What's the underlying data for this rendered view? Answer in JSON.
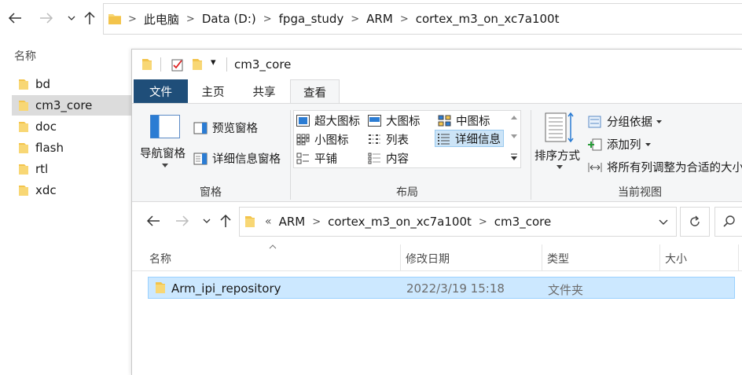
{
  "background_window": {
    "breadcrumb": [
      "此电脑",
      "Data (D:)",
      "fpga_study",
      "ARM",
      "cortex_m3_on_xc7a100t"
    ],
    "column_name": "名称",
    "sidebar_items": [
      {
        "label": "bd",
        "selected": false
      },
      {
        "label": "cm3_core",
        "selected": true
      },
      {
        "label": "doc",
        "selected": false
      },
      {
        "label": "flash",
        "selected": false
      },
      {
        "label": "rtl",
        "selected": false
      },
      {
        "label": "xdc",
        "selected": false
      }
    ]
  },
  "window": {
    "title": "cm3_core",
    "qat_dropdown": "▾",
    "tabs": {
      "file": "文件",
      "home": "主页",
      "share": "共享",
      "view": "查看",
      "active": "查看"
    },
    "ribbon": {
      "panes": {
        "nav_pane": "导航窗格",
        "preview_pane": "预览窗格",
        "details_pane": "详细信息窗格",
        "group_label": "窗格"
      },
      "layout": {
        "items": [
          "超大图标",
          "大图标",
          "中图标",
          "小图标",
          "列表",
          "详细信息",
          "平铺",
          "内容"
        ],
        "selected": "详细信息",
        "group_label": "布局"
      },
      "current_view": {
        "sort_by": "排序方式",
        "group_by": "分组依据",
        "add_columns": "添加列",
        "size_all_columns": "将所有列调整为合适的大小",
        "group_label": "当前视图"
      }
    },
    "address": {
      "overflow": "«",
      "breadcrumb": [
        "ARM",
        "cortex_m3_on_xc7a100t",
        "cm3_core"
      ]
    },
    "file_list": {
      "columns": {
        "name": "名称",
        "modified": "修改日期",
        "type": "类型",
        "size": "大小"
      },
      "rows": [
        {
          "name": "Arm_ipi_repository",
          "modified": "2022/3/19 15:18",
          "type": "文件夹",
          "size": "",
          "selected": true
        }
      ]
    }
  },
  "colors": {
    "file_tab": "#1f4e79",
    "folder_yellow": "#f8d775",
    "selection": "#cce8ff",
    "ribbon_bg": "#f5f6f7"
  }
}
